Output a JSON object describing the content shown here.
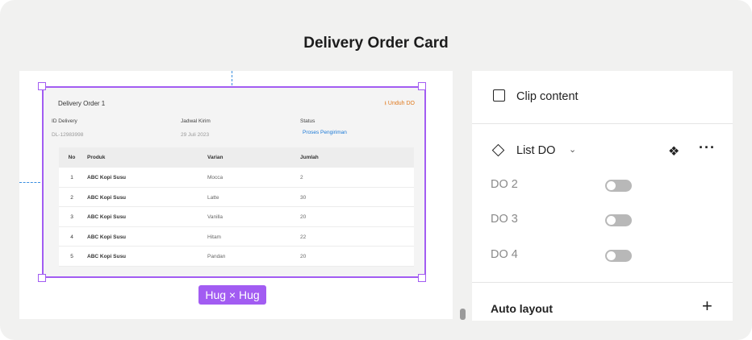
{
  "page": {
    "title": "Delivery Order Card"
  },
  "canvas": {
    "card": {
      "title": "Delivery Order 1",
      "download_label": "Unduh DO",
      "id_label": "ID Delivery",
      "id_value": "DL-12983998",
      "jadwal_label": "Jadwal Kirim",
      "jadwal_value": "29 Juli 2023",
      "status_label": "Status",
      "status_value": "Proses Pengiriman",
      "table": {
        "headers": [
          "No",
          "Produk",
          "Varian",
          "Jumlah"
        ],
        "rows": [
          [
            "1",
            "ABC Kopi Susu",
            "Mocca",
            "2"
          ],
          [
            "2",
            "ABC Kopi Susu",
            "Latte",
            "30"
          ],
          [
            "3",
            "ABC Kopi Susu",
            "Vanilla",
            "20"
          ],
          [
            "4",
            "ABC Kopi Susu",
            "Hitam",
            "22"
          ],
          [
            "5",
            "ABC Kopi Susu",
            "Pandan",
            "20"
          ]
        ]
      }
    },
    "hug_label": "Hug × Hug"
  },
  "panel": {
    "clip_content_label": "Clip content",
    "clip_content_checked": false,
    "list_label": "List DO",
    "variants": [
      {
        "label": "DO 2",
        "enabled": false
      },
      {
        "label": "DO 3",
        "enabled": false
      },
      {
        "label": "DO 4",
        "enabled": false
      }
    ],
    "auto_layout_label": "Auto layout"
  },
  "colors": {
    "accent": "#a25cf2",
    "download": "#e07a1f",
    "status": "#1d7ad6",
    "guide": "#3a8fe0"
  }
}
